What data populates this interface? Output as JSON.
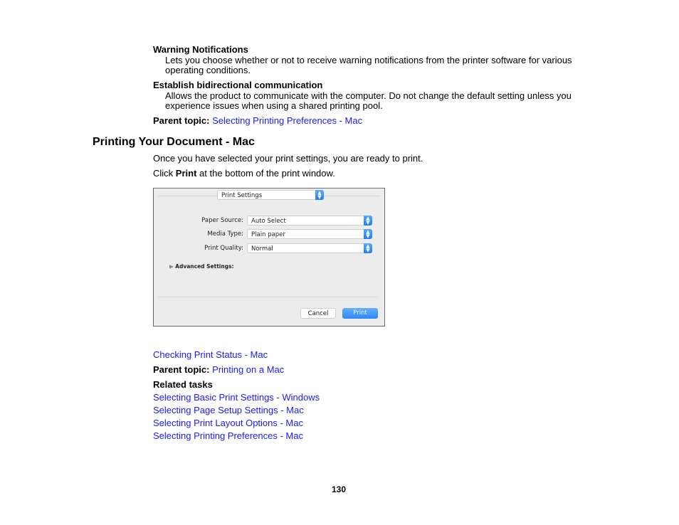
{
  "definitions": [
    {
      "term": "Warning Notifications",
      "lines": [
        "Lets you choose whether or not to receive warning notifications from the printer software for various",
        "operating conditions."
      ]
    },
    {
      "term": "Establish bidirectional communication",
      "lines": [
        "Allows the product to communicate with the computer. Do not change the default setting unless you",
        "experience issues when using a shared printing pool."
      ]
    }
  ],
  "parent_topic_1": {
    "label": "Parent topic:",
    "link": "Selecting Printing Preferences - Mac"
  },
  "section": {
    "title": "Printing Your Document - Mac",
    "intro": "Once you have selected your print settings, you are ready to print.",
    "step_prefix": "Click ",
    "step_bold": "Print",
    "step_suffix": " at the bottom of the print window."
  },
  "dialog": {
    "pane_select": "Print Settings",
    "fields": [
      {
        "label": "Paper Source:",
        "value": "Auto Select"
      },
      {
        "label": "Media Type:",
        "value": "Plain paper"
      },
      {
        "label": "Print Quality:",
        "value": "Normal"
      }
    ],
    "advanced": "Advanced Settings:",
    "cancel": "Cancel",
    "print": "Print",
    "accent_color": "#2b87f7"
  },
  "next_link": "Checking Print Status - Mac",
  "parent_topic_2": {
    "label": "Parent topic:",
    "link": "Printing on a Mac"
  },
  "related": {
    "heading": "Related tasks",
    "links": [
      "Selecting Basic Print Settings - Windows",
      "Selecting Page Setup Settings - Mac",
      "Selecting Print Layout Options - Mac",
      "Selecting Printing Preferences - Mac"
    ]
  },
  "page_number": "130"
}
